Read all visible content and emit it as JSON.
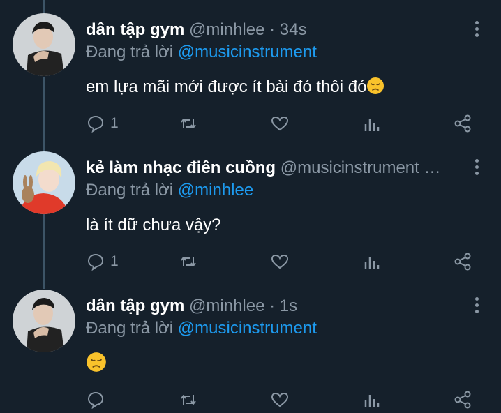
{
  "tweets": [
    {
      "name": "dân tập gym",
      "handle": "@minhlee",
      "time": "34s",
      "reply_prefix": "Đang trả lời",
      "reply_to": "@musicinstrument",
      "text": "em lựa mãi mới được ít bài đó thôi đó",
      "has_emoji": true,
      "reply_count": "1"
    },
    {
      "name": "kẻ làm nhạc điên cuồng",
      "handle": "@musicinstrument …",
      "time": "",
      "reply_prefix": "Đang trả lời",
      "reply_to": "@minhlee",
      "text": "là ít dữ chưa vậy?",
      "has_emoji": false,
      "reply_count": "1"
    },
    {
      "name": "dân tập gym",
      "handle": "@minhlee",
      "time": "1s",
      "reply_prefix": "Đang trả lời",
      "reply_to": "@musicinstrument",
      "text": "",
      "has_emoji": true,
      "reply_count": ""
    }
  ],
  "separator": "·",
  "icons": [
    "reply-icon",
    "retweet-icon",
    "like-icon",
    "analytics-icon",
    "share-icon",
    "more-icon",
    "pensive-face-emoji"
  ],
  "colors": {
    "background": "#15202b",
    "secondary_text": "#8b98a5",
    "accent": "#1d9bf0",
    "thread_line": "#3d5466"
  }
}
